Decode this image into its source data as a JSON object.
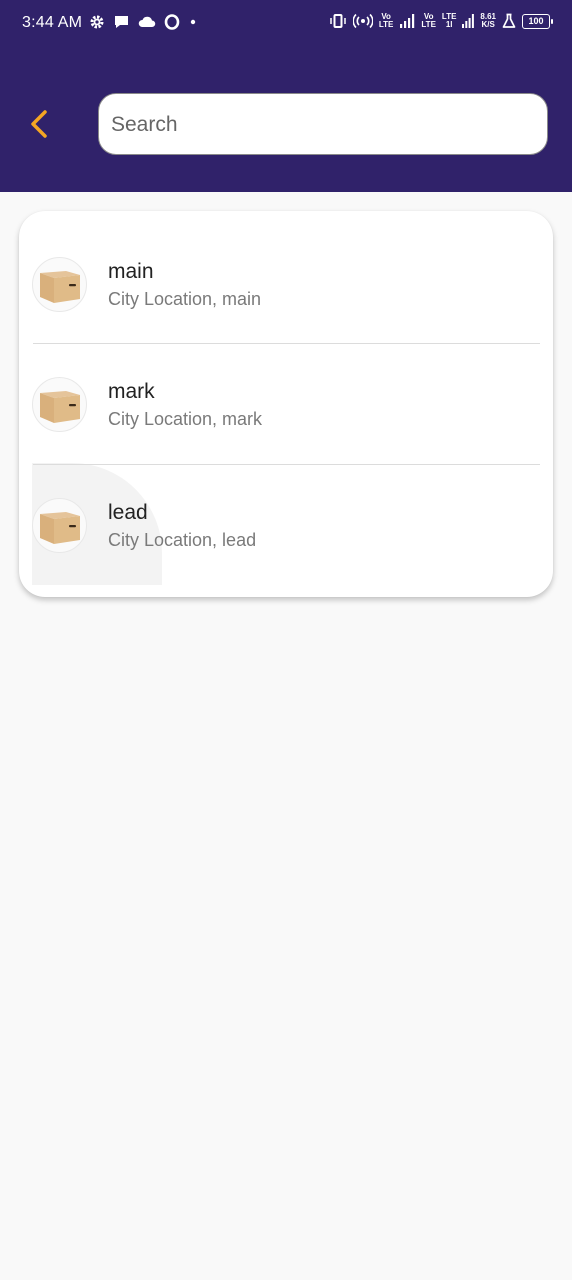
{
  "status_bar": {
    "time": "3:44 AM",
    "net_speed_value": "8.61",
    "net_speed_unit": "K/S",
    "battery": "100",
    "volte1_top": "Vo",
    "volte1_bottom": "LTE",
    "volte2_top": "Vo",
    "volte2_bottom": "LTE",
    "lte_top": "LTE",
    "lte_bottom": "1l"
  },
  "header": {
    "search_placeholder": "Search",
    "accent_color": "#f5a623",
    "bar_color": "#30226a"
  },
  "list": {
    "items": [
      {
        "title": "main",
        "subtitle": "City Location, main",
        "icon": "box-icon"
      },
      {
        "title": "mark",
        "subtitle": "City Location, mark",
        "icon": "box-icon"
      },
      {
        "title": "lead",
        "subtitle": "City Location, lead",
        "icon": "box-icon"
      }
    ]
  }
}
